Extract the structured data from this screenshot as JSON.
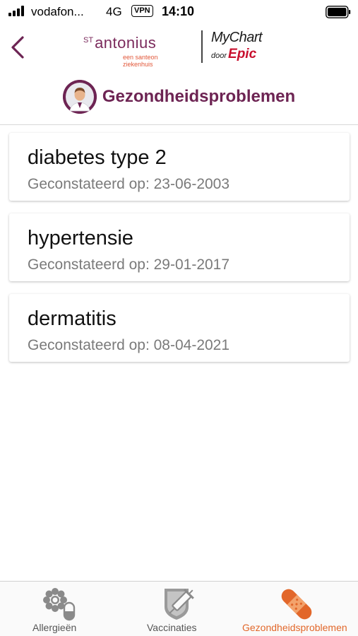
{
  "status_bar": {
    "carrier": "vodafon...",
    "network": "4G",
    "vpn": "VPN",
    "time": "14:10"
  },
  "header": {
    "brand_prefix": "ST",
    "brand_name": "antonius",
    "brand_tagline": "een santeon ziekenhuis",
    "mychart_label": "MyChart",
    "mychart_by": "door",
    "mychart_epic": "Epic"
  },
  "page": {
    "title": "Gezondheidsproblemen"
  },
  "problems": [
    {
      "name": "diabetes type 2",
      "date": "Geconstateerd op: 23-06-2003"
    },
    {
      "name": "hypertensie",
      "date": "Geconstateerd op: 29-01-2017"
    },
    {
      "name": "dermatitis",
      "date": "Geconstateerd op: 08-04-2021"
    }
  ],
  "tabs": [
    {
      "label": "Allergieën",
      "icon": "allergy-icon",
      "active": false
    },
    {
      "label": "Vaccinaties",
      "icon": "vaccine-icon",
      "active": false
    },
    {
      "label": "Gezondheidsproblemen",
      "icon": "bandage-icon",
      "active": true
    }
  ],
  "colors": {
    "brand_purple": "#6d2453",
    "active_orange": "#e2672a",
    "epic_red": "#c8102e"
  }
}
